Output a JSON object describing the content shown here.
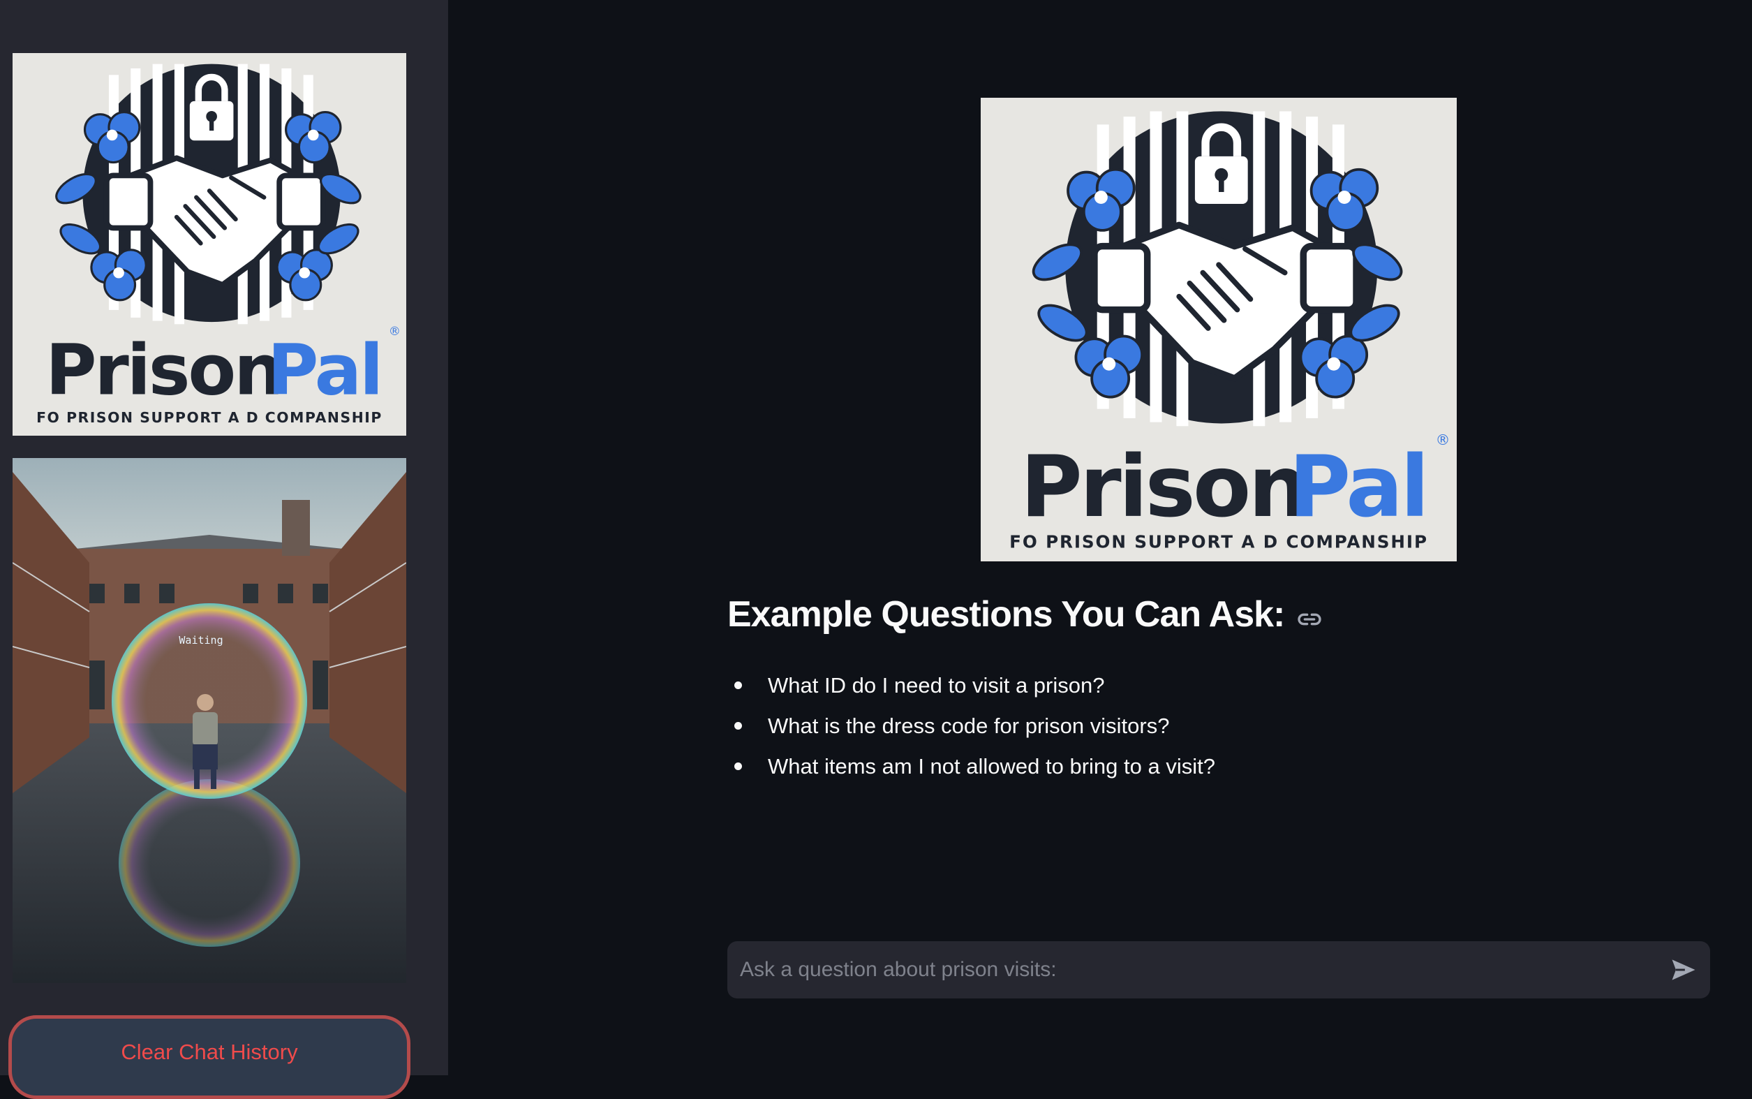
{
  "sidebar": {
    "logo": {
      "brand_dark": "Prison",
      "brand_accent": "Pal",
      "tagline": "FO PRISON SUPPORT A D COMPANSHIP",
      "registered": "®",
      "brand_color": "#1f2530",
      "accent_color": "#3a79e0"
    },
    "photo": {
      "bubble_text": "Waiting"
    },
    "clear_button": "Clear Chat History"
  },
  "main": {
    "logo": {
      "brand_dark": "Prison",
      "brand_accent": "Pal",
      "tagline": "FO PRISON SUPPORT A D COMPANSHIP",
      "registered": "®"
    },
    "heading": "Example Questions You Can Ask:",
    "heading_icon": "link-icon",
    "questions": [
      "What ID do I need to visit a prison?",
      "What is the dress code for prison visitors?",
      "What items am I not allowed to bring to a visit?"
    ],
    "chat": {
      "placeholder": "Ask a question about prison visits:",
      "send_icon": "send-icon"
    }
  },
  "colors": {
    "page_bg": "#0e1117",
    "sidebar_bg": "#262730",
    "button_text": "#f04b4b",
    "button_border": "#b44b4b"
  }
}
